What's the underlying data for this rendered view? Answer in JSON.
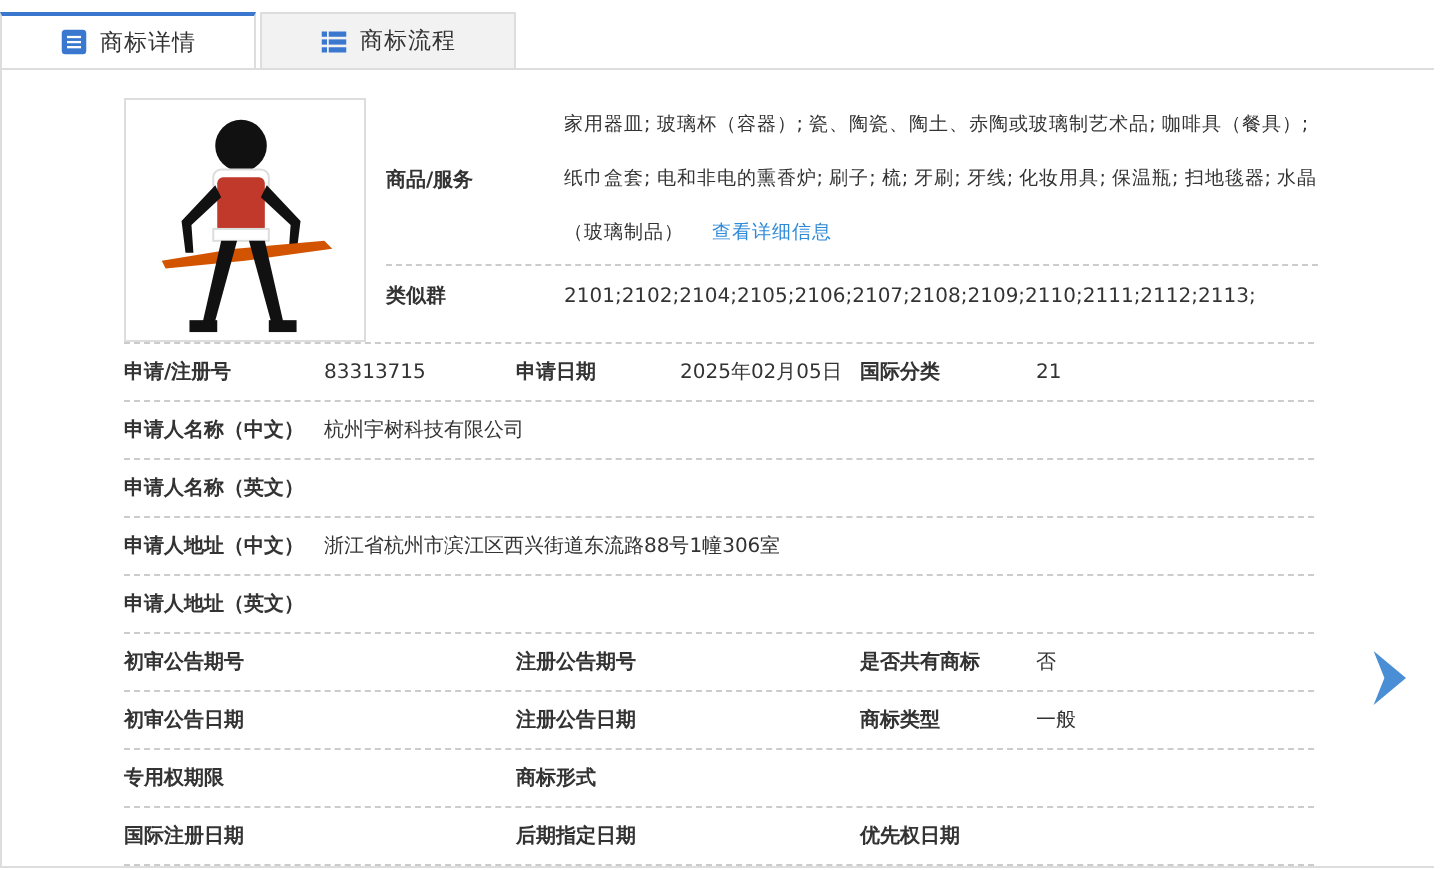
{
  "tabs": [
    {
      "label": "商标详情",
      "selected": true
    },
    {
      "label": "商标流程",
      "selected": false
    }
  ],
  "trademark": {
    "goods": {
      "label": "商品/服务",
      "lines": [
        "家用器皿; 玻璃杯（容器）; 瓷、陶瓷、陶土、赤陶或玻璃制艺术品; 咖啡具（餐具）;",
        "纸巾盒套; 电和非电的熏香炉; 刷子; 梳; 牙刷; 牙线; 化妆用具; 保温瓶; 扫地毯器; 水晶",
        "（玻璃制品）"
      ],
      "link": "查看详细信息"
    },
    "similar": {
      "label": "类似群",
      "value": "2101;2102;2104;2105;2106;2107;2108;2109;2110;2111;2112;2113;"
    }
  },
  "reg_row": [
    {
      "label": "申请/注册号",
      "value": "83313715"
    },
    {
      "label": "申请日期",
      "value": "2025年02月05日"
    },
    {
      "label": "国际分类",
      "value": "21"
    }
  ],
  "wide_rows": [
    {
      "label": "申请人名称（中文）",
      "value": "杭州宇树科技有限公司"
    },
    {
      "label": "申请人名称（英文）"
    },
    {
      "label": "申请人地址（中文）",
      "value": "浙江省杭州市滨江区西兴街道东流路88号1幢306室"
    },
    {
      "label": "申请人地址（英文）"
    }
  ],
  "grid_rows": [
    [
      {
        "label": "初审公告期号"
      },
      {
        "label": "注册公告期号"
      },
      {
        "label": "是否共有商标",
        "value": "否"
      }
    ],
    [
      {
        "label": "初审公告日期"
      },
      {
        "label": "注册公告日期"
      },
      {
        "label": "商标类型",
        "value": "一般"
      }
    ],
    [
      {
        "label": "专用权期限"
      },
      {
        "label": "商标形式"
      }
    ],
    [
      {
        "label": "国际注册日期"
      },
      {
        "label": "后期指定日期"
      },
      {
        "label": "优先权日期"
      }
    ]
  ]
}
